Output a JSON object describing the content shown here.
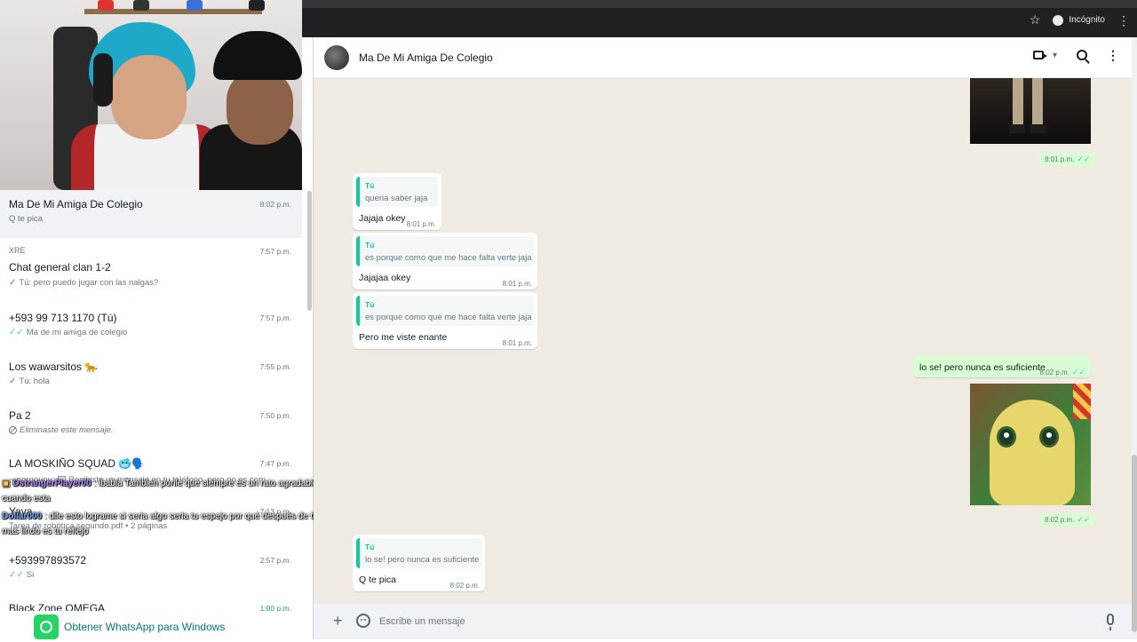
{
  "browser": {
    "mode_label": "Incógnito"
  },
  "sidebar": {
    "chats": [
      {
        "name": "Ma De Mi Amiga De Colegio",
        "time": "8:02 p.m.",
        "preview": "Q te pica",
        "group": "",
        "tick": ""
      },
      {
        "name": "Chat general clan 1-2",
        "time": "7:57 p.m.",
        "preview": "Tú: pero puedo jugar con las nalgas?",
        "group": "XRE",
        "tick": "✓"
      },
      {
        "name": "+593 99 713 1170 (Tú)",
        "time": "7:57 p.m.",
        "preview": "Ma de mi amiga de colegio",
        "group": "",
        "tick": "✓✓"
      },
      {
        "name": "Los wawarsitos 🐆",
        "time": "7:55 p.m.",
        "preview": "Tú: hola",
        "group": "",
        "tick": "✓"
      },
      {
        "name": "Pa 2",
        "time": "7:50 p.m.",
        "preview": "Eliminaste este mensaje.",
        "group": "",
        "tick": ""
      },
      {
        "name": "LA MOSKIÑO SQUAD 🥶🗣️",
        "time": "7:47 p.m.",
        "preview": "~ логронон: 🖾 Recibiste un mensaje en tu teléfono, pero no es com...",
        "group": "",
        "tick": ""
      },
      {
        "name": "Yaya",
        "time": "7:13 p.m.",
        "preview": "Tarea de robótica segundo.pdf • 2 páginas",
        "group": "",
        "tick": ""
      },
      {
        "name": "+593997893572",
        "time": "2:57 p.m.",
        "preview": "Si",
        "group": "",
        "tick": "✓✓"
      },
      {
        "name": "Black Zone OMEGA",
        "time": "1:00 p.m.",
        "preview": "",
        "group": "",
        "tick": ""
      }
    ],
    "get_app_label": "Obtener WhatsApp para Windows"
  },
  "stream_chat": [
    {
      "user": "DstrangerPlayer00",
      "message": ": ibabla Tambien ponle que siempre es un rato agradable",
      "cont": "cuando esta"
    },
    {
      "user": "Dollar000",
      "message": ": dile esto lograme si seria algo seria tu espejo por qué después de ti lo",
      "cont": "mas lindo es tu reflejo"
    }
  ],
  "chat": {
    "contact_name": "Ma De Mi Amiga De Colegio",
    "messages": [
      {
        "quote_author": "Tú",
        "quote_text": "queria saber jaja",
        "text": "Jajaja okey",
        "time": "8:01 p.m."
      },
      {
        "quote_author": "Tú",
        "quote_text": "es porque como que me hace falta verte jaja",
        "text": "Jajajaa okey",
        "time": "8:01 p.m."
      },
      {
        "quote_author": "Tú",
        "quote_text": "es porque como que me hace falta verte jaja",
        "text": "Pero me viste  enante",
        "time": "8:01 p.m."
      },
      {
        "quote_author": "Tú",
        "quote_text": "lo se! pero nunca es suficiente",
        "text": "Q te pica",
        "time": "8:02 p.m."
      }
    ],
    "outgoing": {
      "image1_time": "8:01 p.m.",
      "text": "lo se! pero nunca es suficiente",
      "text_time": "8:02 p.m.",
      "image2_time": "8:02 p.m."
    },
    "read_tick": "✓✓"
  },
  "composer": {
    "placeholder": "Escribe un mensaje"
  },
  "colors": {
    "wa_green": "#25d366",
    "outgoing_bubble": "#d9fdd3",
    "chat_bg": "#efeae2",
    "read_tick_blue": "#53bdeb",
    "quote_bar": "#06cf9c"
  }
}
